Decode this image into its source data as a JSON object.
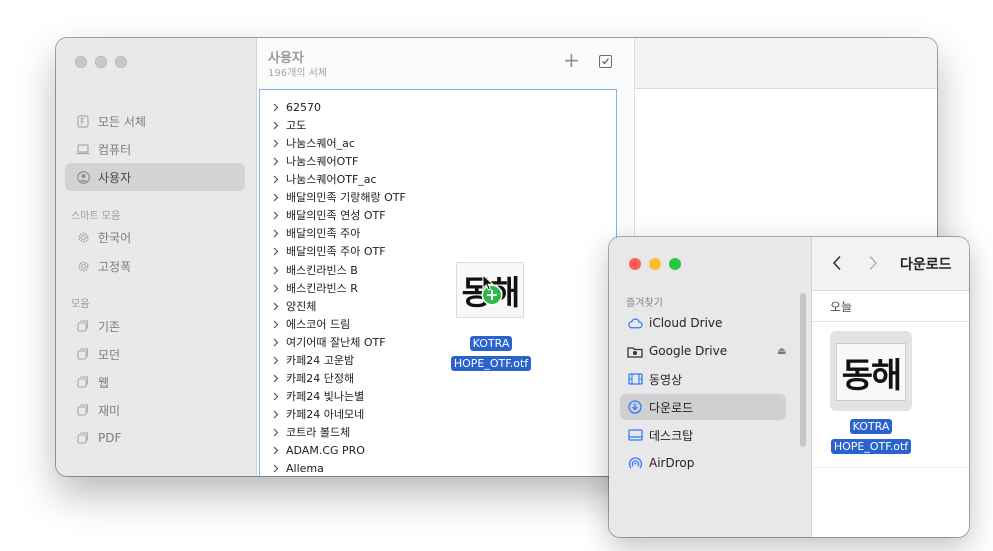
{
  "font_book": {
    "sidebar": {
      "items": [
        {
          "label": "모든 서체",
          "icon": "font-icon"
        },
        {
          "label": "컴퓨터",
          "icon": "laptop-icon"
        },
        {
          "label": "사용자",
          "icon": "user-icon",
          "selected": true
        }
      ],
      "smart_header": "스마트 모음",
      "smart_items": [
        {
          "label": "한국어",
          "icon": "gear-icon"
        },
        {
          "label": "고정폭",
          "icon": "gear-icon"
        }
      ],
      "collections_header": "모음",
      "collections": [
        {
          "label": "기존",
          "icon": "collection-icon"
        },
        {
          "label": "모던",
          "icon": "collection-icon"
        },
        {
          "label": "웹",
          "icon": "collection-icon"
        },
        {
          "label": "재미",
          "icon": "collection-icon"
        },
        {
          "label": "PDF",
          "icon": "collection-icon"
        }
      ]
    },
    "list": {
      "title": "사용자",
      "subtitle": "196개의 서체",
      "add_button": "+",
      "fonts": [
        "62570",
        "고도",
        "나눔스퀘어_ac",
        "나눔스퀘어OTF",
        "나눔스퀘어OTF_ac",
        "배달의민족 기랑해랑 OTF",
        "배달의민족 연성 OTF",
        "배달의민족 주아",
        "배달의민족 주아 OTF",
        "배스킨라빈스 B",
        "배스킨라빈스 R",
        "양진체",
        "에스코어 드림",
        "여기어때 잘난체 OTF",
        "카페24 고운밤",
        "카페24 단정해",
        "카페24 빛나는별",
        "카페24 아네모네",
        "코트라 볼드체",
        "ADAM.CG PRO",
        "Allema"
      ]
    }
  },
  "drag_item": {
    "thumb_text": "동해",
    "badge": "+",
    "label_line1": "KOTRA",
    "label_line2": "HOPE_OTF.otf"
  },
  "finder": {
    "favorites_header": "즐겨찾기",
    "favorites": [
      {
        "label": "iCloud Drive",
        "icon": "cloud-icon"
      },
      {
        "label": "Google Drive",
        "icon": "drive-icon",
        "eject": true
      },
      {
        "label": "동영상",
        "icon": "film-icon"
      },
      {
        "label": "다운로드",
        "icon": "download-icon",
        "selected": true
      },
      {
        "label": "데스크탑",
        "icon": "desktop-icon"
      },
      {
        "label": "AirDrop",
        "icon": "airdrop-icon"
      }
    ],
    "title": "다운로드",
    "section": "오늘",
    "file": {
      "thumb_text": "동해",
      "label_line1": "KOTRA",
      "label_line2": "HOPE_OTF.otf"
    }
  },
  "colors": {
    "selection_blue": "#2a63cc",
    "accent_blue": "#2f7cf6",
    "close": "#ff5f57",
    "minimize": "#febc2e",
    "zoom": "#28c840"
  }
}
